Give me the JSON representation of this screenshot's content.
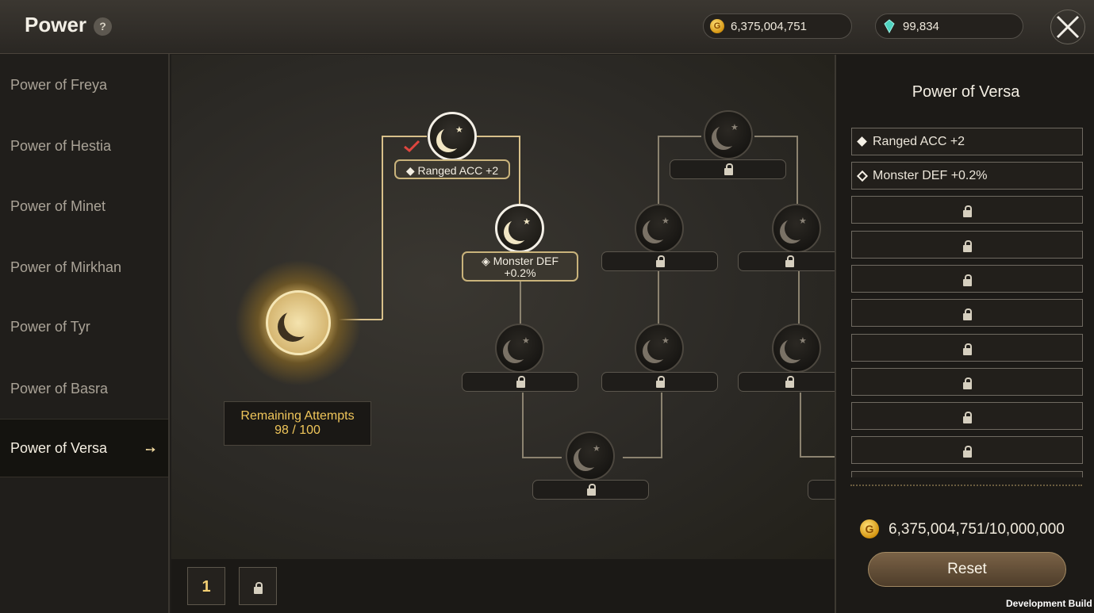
{
  "header": {
    "title": "Power",
    "help_label": "?",
    "gold_icon_letter": "G",
    "gold_amount": "6,375,004,751",
    "gem_amount": "99,834",
    "close_icon": "close-x-icon"
  },
  "sidebar": {
    "items": [
      {
        "label": "Power of Freya"
      },
      {
        "label": "Power of Hestia"
      },
      {
        "label": "Power of Minet"
      },
      {
        "label": "Power of Mirkhan"
      },
      {
        "label": "Power of Tyr"
      },
      {
        "label": "Power of Basra"
      },
      {
        "label": "Power of Versa",
        "active": true
      }
    ],
    "active_arrow": "➙"
  },
  "board": {
    "remaining_label": "Remaining Attempts",
    "remaining_value": "98 / 100",
    "node_ranged": "Ranged ACC +2",
    "node_monster_line1": "Monster DEF",
    "node_monster_line2": "+0.2%",
    "pages": [
      "1"
    ]
  },
  "panel": {
    "title": "Power of Versa",
    "slots": [
      {
        "text": "Ranged ACC +2",
        "locked": false
      },
      {
        "text": "Monster DEF +0.2%",
        "locked": false
      },
      {
        "text": "",
        "locked": true
      },
      {
        "text": "",
        "locked": true
      },
      {
        "text": "",
        "locked": true
      },
      {
        "text": "",
        "locked": true
      },
      {
        "text": "",
        "locked": true
      },
      {
        "text": "",
        "locked": true
      },
      {
        "text": "",
        "locked": true
      },
      {
        "text": "",
        "locked": true
      }
    ],
    "cost": "6,375,004,751/10,000,000",
    "cost_icon_letter": "G",
    "reset_label": "Reset"
  },
  "footer": {
    "dev_build": "Development Build"
  },
  "colors": {
    "accent_gold": "#f0c65a",
    "panel_bg": "#1c1a17"
  }
}
